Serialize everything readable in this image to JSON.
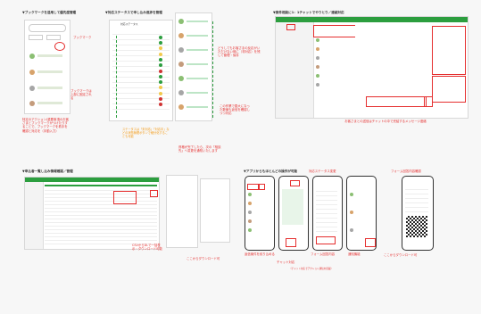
{
  "panels": {
    "p1": {
      "title": "▼ブックマークを活用して優先度管理",
      "callout1": "ブックマーク",
      "callout2": "ブックマークは上部に固定される",
      "note": "特定のアクション(重要事項のお客さまとブックマークがつけたりすることで、ブックマークを着手を確認と対応を（手動入力）"
    },
    "p2": {
      "title": "▼対応ステータスで申し込み進捗を管理",
      "header": "対応ステータス",
      "note1": "どうしてもお客さまの反応がいただけない時に（非対応）を残して管理・保存",
      "note2": "この作業で膨大になった数値も返信を確認しつつ対応",
      "note3": "ステータスは「未対応」「対応中」などの状態管理ボタンで細分化することも可能",
      "note4": "資格が完了したら、次の「相談先」へ変更を通知いたします"
    },
    "p3": {
      "title": "▼案件相談に1：1チャットでやりとり／連絡対応",
      "caption": "お客さまとの送信はチャットの中で完結するメッセージ連絡"
    },
    "p4": {
      "title": "▼申込者一覧し込み情報確認／管理",
      "callout1": "CSVからDLで一括表示・ダウンロード可能",
      "callout2": "ここからダウンロード可"
    },
    "p5": {
      "title": "▼アプリからもほとんどの操作が可能",
      "callout1": "対応ステータス変更",
      "callout2": "返信案件を絞り込める",
      "callout3": "チャット対応",
      "callout4": "フォーム回答内容",
      "callout5": "通知機能",
      "callout6": "（チャット対応でアクション通知を搭載）"
    },
    "p6": {
      "callout1": "フォーム回答内容確認",
      "callout2": "ここからダウンロード可"
    }
  }
}
